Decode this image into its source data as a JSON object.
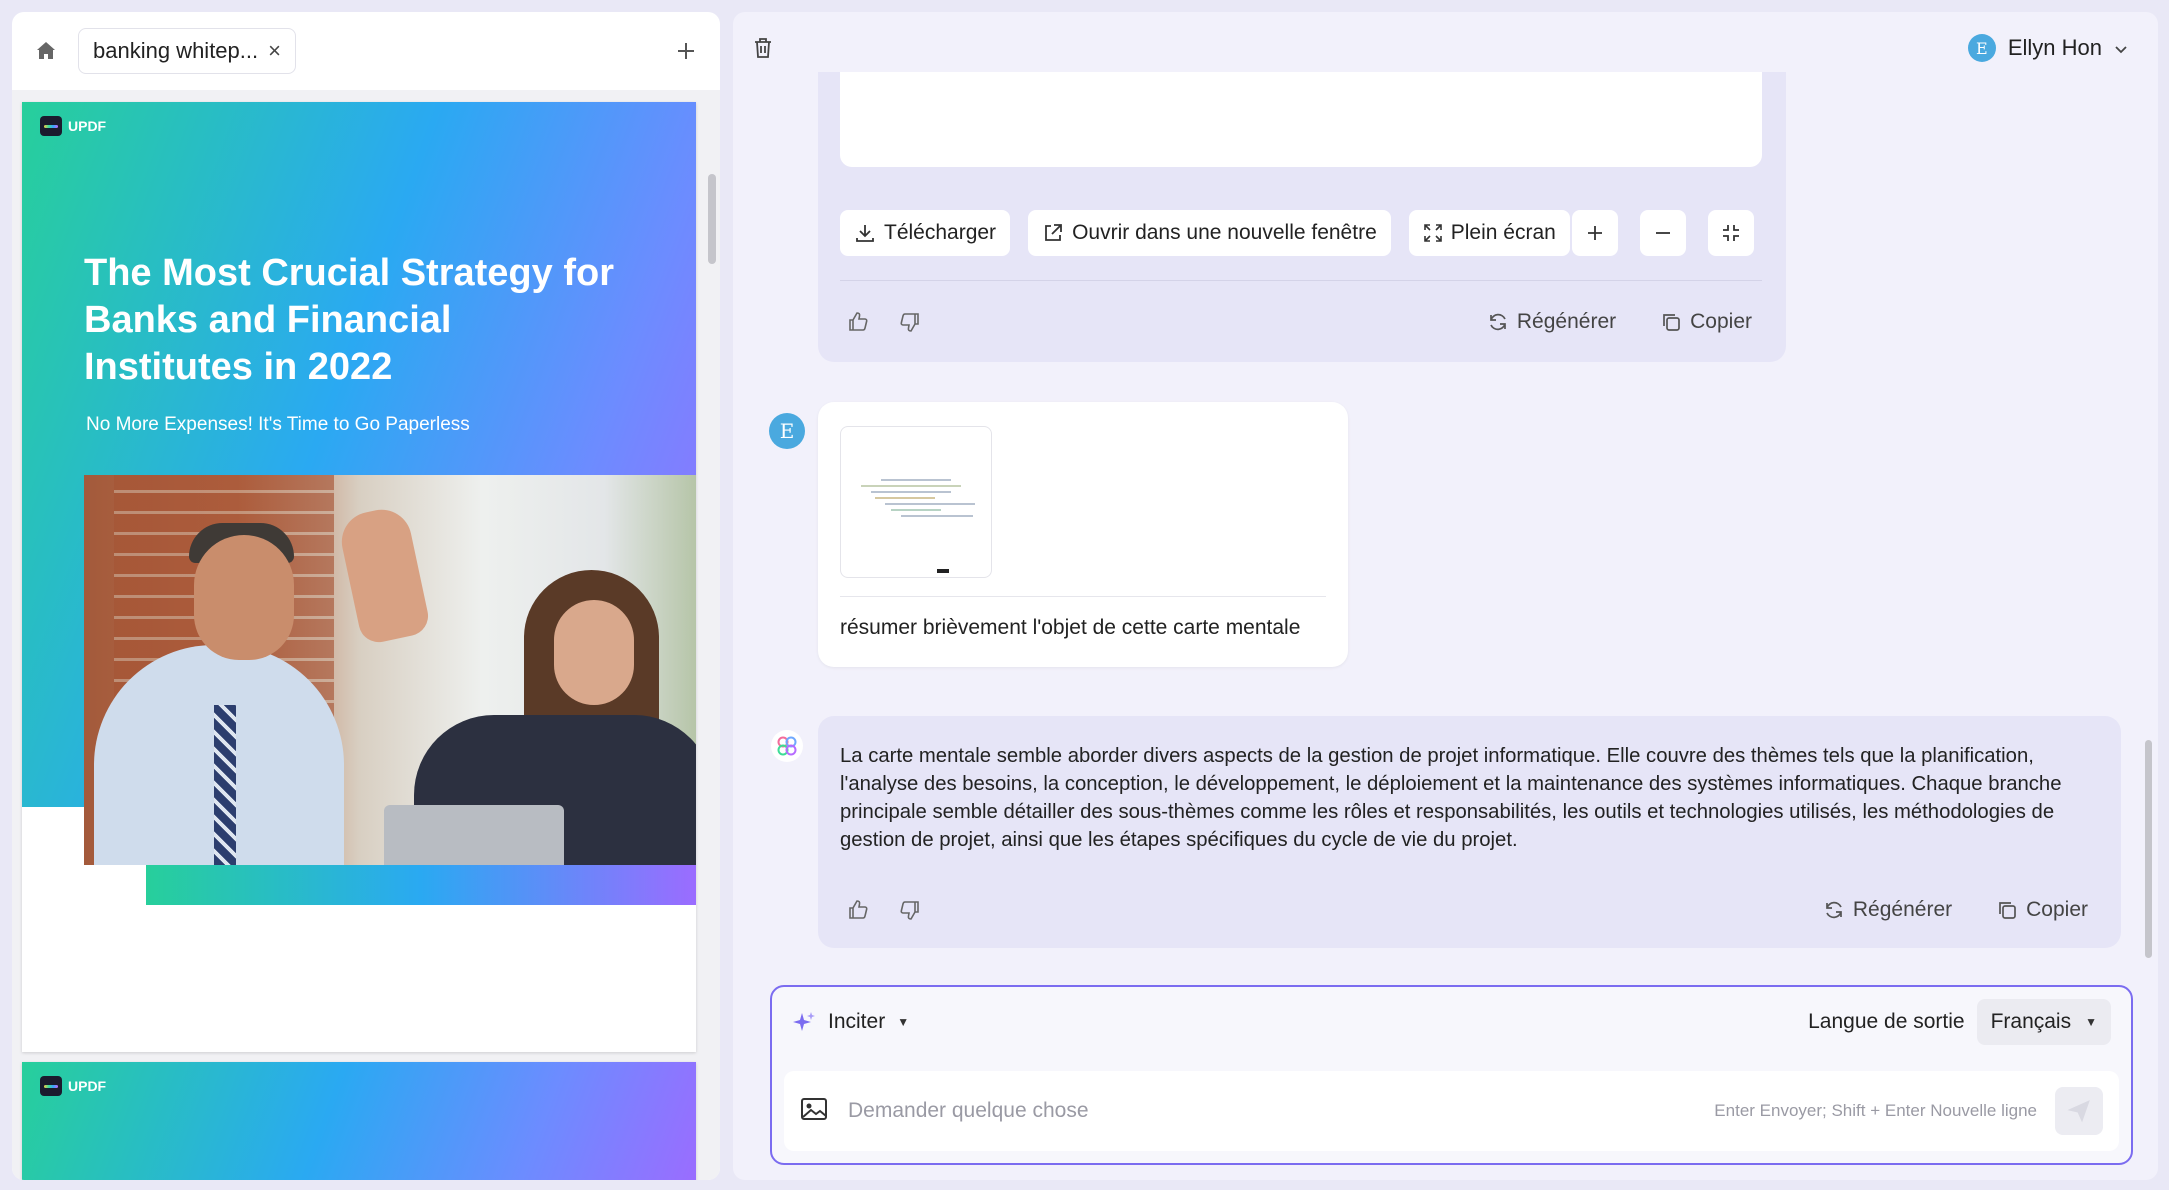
{
  "left_panel": {
    "tab_label": "banking whitep...",
    "close_glyph": "×",
    "home_icon": "home-icon",
    "add_tab_icon": "plus-icon"
  },
  "document": {
    "logo_text": "UPDF",
    "title": "The Most Crucial Strategy for Banks and Financial Institutes in 2022",
    "subtitle": "No More Expenses! It's Time to Go Paperless",
    "page2_logo_text": "UPDF"
  },
  "header": {
    "delete_icon": "trash-icon",
    "user_initial": "E",
    "user_name": "Ellyn Hon"
  },
  "message1": {
    "download_label": "Télécharger",
    "open_new_window_label": "Ouvrir dans une nouvelle fenêtre",
    "fullscreen_label": "Plein écran",
    "regenerate_label": "Régénérer",
    "copy_label": "Copier"
  },
  "user_message": {
    "avatar_initial": "E",
    "text": "résumer brièvement l'objet de cette carte mentale"
  },
  "ai_message": {
    "text": "La carte mentale semble aborder divers aspects de la gestion de projet informatique. Elle couvre des thèmes tels que la planification, l'analyse des besoins, la conception, le développement, le déploiement et la maintenance des systèmes informatiques. Chaque branche principale semble détailler des sous-thèmes comme les rôles et responsabilités, les outils et technologies utilisés, les méthodologies de gestion de projet, ainsi que les étapes spécifiques du cycle de vie du projet.",
    "regenerate_label": "Régénérer",
    "copy_label": "Copier"
  },
  "composer": {
    "prompt_label": "Inciter",
    "output_language_label": "Langue de sortie",
    "language_value": "Français",
    "placeholder": "Demander quelque chose",
    "hint": "Enter Envoyer; Shift + Enter Nouvelle ligne"
  },
  "colors": {
    "accent": "#7b6cf0",
    "assistant_bubble": "#e6e5f7",
    "avatar": "#4aa9df"
  }
}
